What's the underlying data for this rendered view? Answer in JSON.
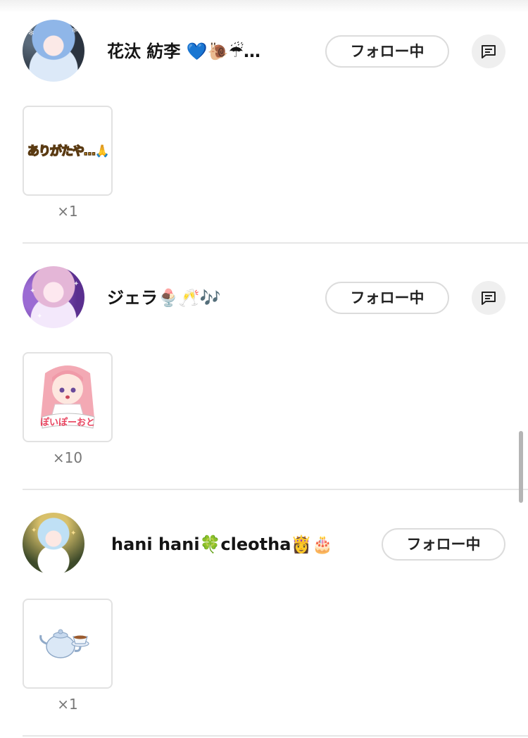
{
  "entries": [
    {
      "name": "花汰 紡李 💙🐌☔…",
      "follow_label": "フォロー中",
      "gift": {
        "text": "ありがたや…🙏",
        "count": "×1"
      }
    },
    {
      "name": "ジェラ🍨🥂🎶",
      "follow_label": "フォロー中",
      "gift": {
        "text": "ぽいぽーおと",
        "count": "×10"
      }
    },
    {
      "name": "hani hani🍀cleotha👸🎂",
      "follow_label": "フォロー中",
      "gift": {
        "text": "",
        "count": "×1"
      }
    }
  ],
  "icons": {
    "message": "message-icon"
  },
  "colors": {
    "follow_border": "#dcdcdc",
    "divider": "#e6e6e6",
    "message_bg": "#efefef"
  }
}
